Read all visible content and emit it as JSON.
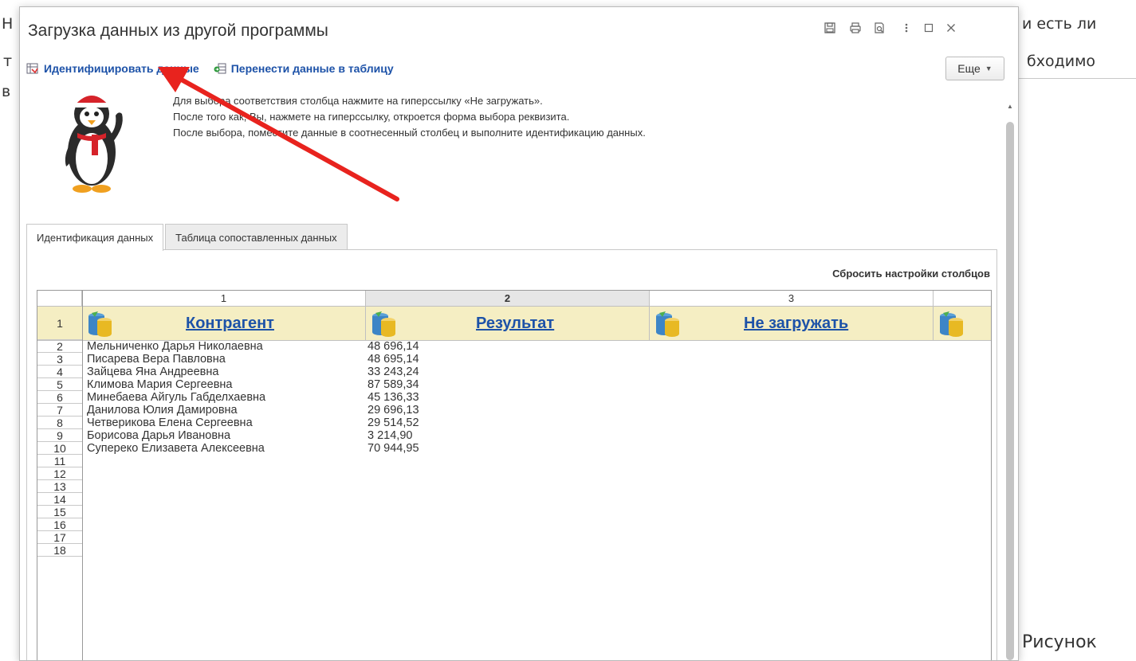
{
  "background": {
    "line1_left": "Н",
    "line1_right": "и есть ли",
    "line2_left": "т",
    "line2_right": "бходимо",
    "line3_left": "в",
    "caption": "Рисунок"
  },
  "dialog": {
    "title": "Загрузка данных из другой программы",
    "toolbar": {
      "identify_label": "Идентифицировать данные",
      "transfer_label": "Перенести данные в таблицу",
      "more_label": "Еще"
    },
    "instructions": [
      "Для выбора соответствия столбца нажмите на гиперссылку «Не загружать».",
      "После того как, Вы, нажмете на гиперссылку, откроется форма выбора реквизита.",
      "После выбора, поместите данные в соотнесенный столбец и выполните идентификацию данных."
    ],
    "tabs": [
      {
        "label": "Идентификация данных"
      },
      {
        "label": "Таблица сопоставленных данных"
      }
    ],
    "reset_label": "Сбросить настройки столбцов",
    "table": {
      "column_numbers": [
        "1",
        "2",
        "3"
      ],
      "header_row_number": "1",
      "column_links": [
        "Контрагент",
        "Результат",
        "Не загружать"
      ],
      "rows": [
        {
          "n": "2",
          "name": "Мельниченко Дарья Николаевна",
          "value": "48 696,14"
        },
        {
          "n": "3",
          "name": "Писарева Вера Павловна",
          "value": "48 695,14"
        },
        {
          "n": "4",
          "name": "Зайцева Яна Андреевна",
          "value": "33 243,24"
        },
        {
          "n": "5",
          "name": "Климова Мария Сергеевна",
          "value": "87 589,34"
        },
        {
          "n": "6",
          "name": "Минебаева Айгуль Габделхаевна",
          "value": "45 136,33"
        },
        {
          "n": "7",
          "name": "Данилова Юлия Дамировна",
          "value": "29 696,13"
        },
        {
          "n": "8",
          "name": "Четверикова Елена Сергеевна",
          "value": "29 514,52"
        },
        {
          "n": "9",
          "name": "Борисова Дарья Ивановна",
          "value": "3 214,90"
        },
        {
          "n": "10",
          "name": "Супереко Елизавета Алексеевна",
          "value": "70 944,95"
        }
      ],
      "empty_rows": [
        "11",
        "12",
        "13",
        "14",
        "15",
        "16",
        "17",
        "18"
      ]
    }
  },
  "colors": {
    "link": "#1d52a8",
    "header_bg": "#f5eec3",
    "arrow": "#e8231e"
  }
}
